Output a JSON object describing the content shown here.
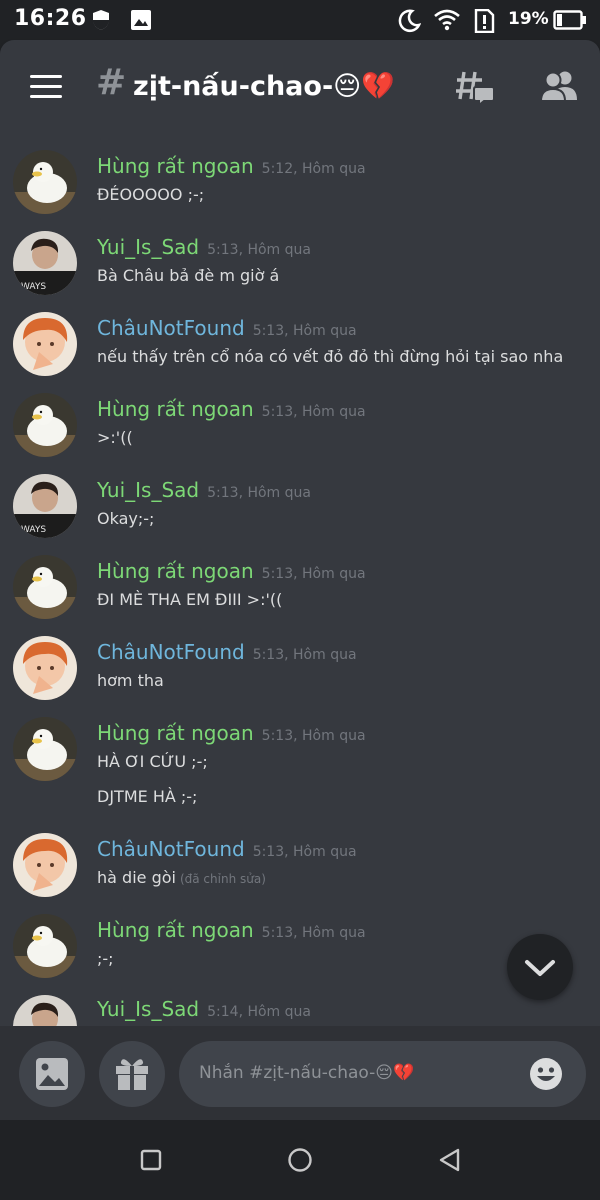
{
  "status_bar": {
    "time": "16:26",
    "battery": "19%"
  },
  "header": {
    "hash": "#",
    "channel_name": "zịt-nấu-chao-😔💔"
  },
  "colors": {
    "hung_name": "#7dd876",
    "yui_name": "#7dd876",
    "chau_name": "#6fb6dc",
    "background": "#36393f",
    "header": "#202225"
  },
  "messages": [
    {
      "author": "Hùng rất ngoan",
      "time": "5:12, Hôm qua",
      "lines": [
        "ĐÉOOOOO ;-;"
      ]
    },
    {
      "author": "Yui_Is_Sad",
      "time": "5:13, Hôm qua",
      "lines": [
        "Bà Châu bả đè m giờ á"
      ]
    },
    {
      "author": "ChâuNotFound",
      "time": "5:13, Hôm qua",
      "lines": [
        "nếu thấy trên cổ nóa có vết đỏ đỏ thì đừng hỏi tại sao nha"
      ]
    },
    {
      "author": "Hùng rất ngoan",
      "time": "5:13, Hôm qua",
      "lines": [
        ">:'(("
      ]
    },
    {
      "author": "Yui_Is_Sad",
      "time": "5:13, Hôm qua",
      "lines": [
        "Okay;-;"
      ]
    },
    {
      "author": "Hùng rất ngoan",
      "time": "5:13, Hôm qua",
      "lines": [
        "ĐI MÈ THA EM ĐIII >:'(("
      ]
    },
    {
      "author": "ChâuNotFound",
      "time": "5:13, Hôm qua",
      "lines": [
        "hơm tha"
      ]
    },
    {
      "author": "Hùng rất ngoan",
      "time": "5:13, Hôm qua",
      "lines": [
        "HÀ ƠI CỨU ;-;",
        "DJTME HÀ ;-;"
      ]
    },
    {
      "author": "ChâuNotFound",
      "time": "5:13, Hôm qua",
      "lines": [
        "hà die gòi"
      ],
      "edited": "(đã chỉnh sửa)"
    },
    {
      "author": "Hùng rất ngoan",
      "time": "5:13, Hôm qua",
      "lines": [
        ";-;"
      ]
    },
    {
      "author": "Yui_Is_Sad",
      "time": "5:14, Hôm qua",
      "lines": []
    }
  ],
  "input": {
    "placeholder": "Nhắn #zịt-nấu-chao-😔💔"
  },
  "icons": {
    "menu": "hamburger-icon",
    "threads": "threads-icon",
    "members": "members-icon",
    "image": "image-icon",
    "gift": "gift-icon",
    "emoji": "emoji-icon",
    "scroll": "chevron-down-icon"
  }
}
